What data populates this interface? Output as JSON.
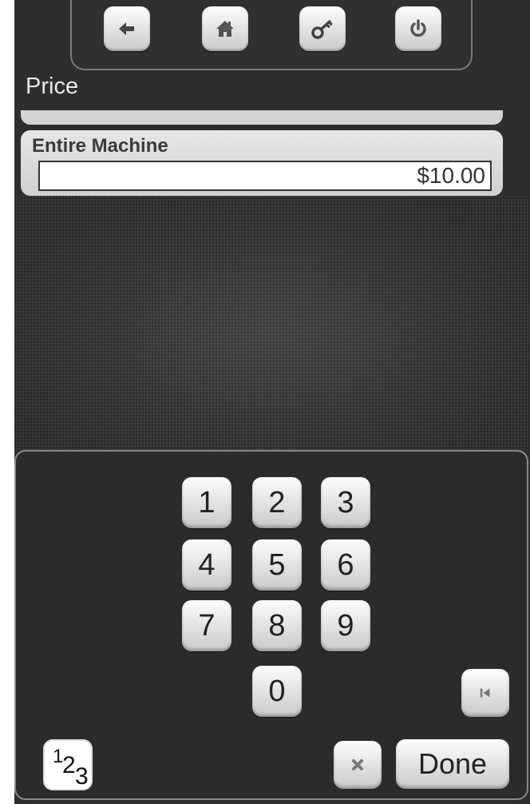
{
  "toolbar": {
    "buttons": [
      {
        "icon": "back-arrow-icon"
      },
      {
        "icon": "home-icon"
      },
      {
        "icon": "key-icon"
      },
      {
        "icon": "power-icon"
      }
    ]
  },
  "page": {
    "title": "Price"
  },
  "field": {
    "label": "Entire Machine",
    "value": "$10.00"
  },
  "keypad": {
    "keys": [
      "1",
      "2",
      "3",
      "4",
      "5",
      "6",
      "7",
      "8",
      "9",
      "0"
    ],
    "mode_digits": [
      "1",
      "2",
      "3"
    ],
    "done_label": "Done"
  }
}
